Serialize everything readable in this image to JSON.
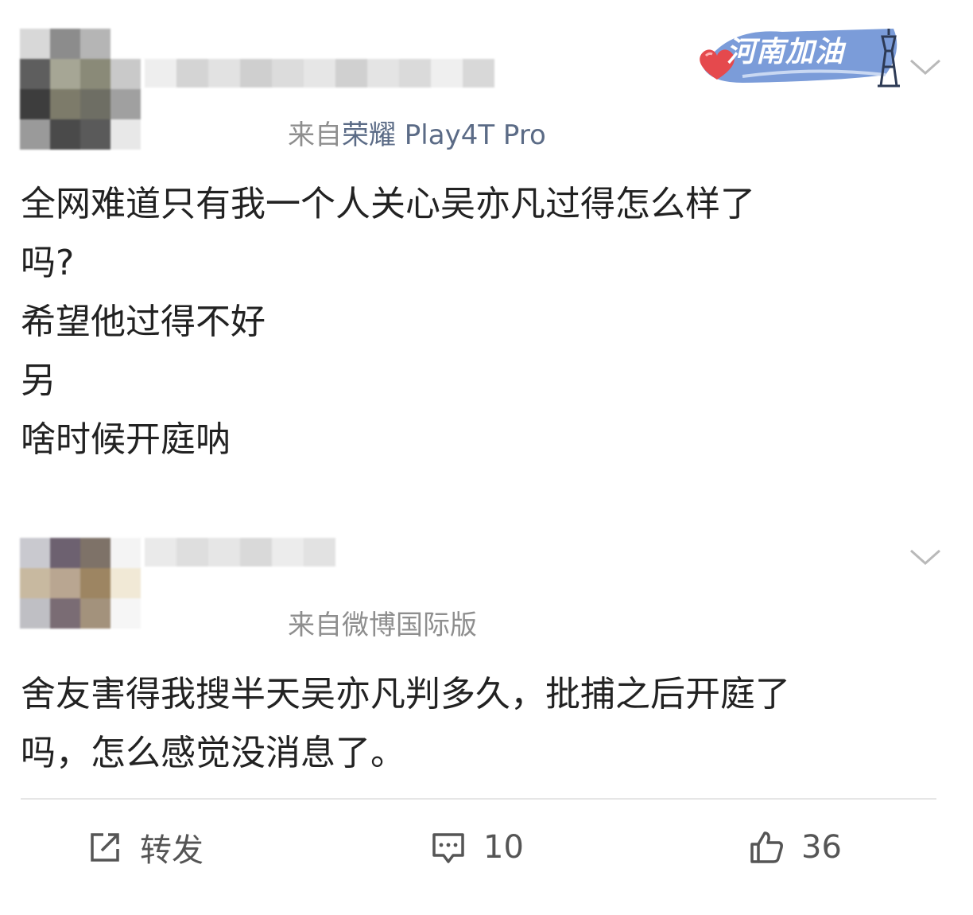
{
  "posts": [
    {
      "source_prefix": "来自",
      "source_device": "荣耀 Play4T Pro",
      "badge_text": "河南加油",
      "content": [
        "全网难道只有我一个人关心吴亦凡过得怎么样了",
        "吗?",
        "希望他过得不好",
        "另",
        "啥时候开庭呐"
      ],
      "avatar_colors": [
        "#d8d8d8",
        "#8c8c8c",
        "#b5b5b5",
        "#ffffff",
        "#5e5e5e",
        "#a6a695",
        "#8a8a78",
        "#c9c9c9",
        "#3d3d3d",
        "#7d7b6a",
        "#6e6e64",
        "#a0a0a0",
        "#9a9a9a",
        "#4a4a4a",
        "#5a5a5a",
        "#e8e8e8"
      ],
      "nick_colors": [
        "#eeeeee",
        "#d4d4d4",
        "#e2e2e2",
        "#cfcfcf",
        "#dcdcdc",
        "#e6e6e6",
        "#d0d0d0",
        "#e4e4e4",
        "#dadada",
        "#efefef",
        "#d8d8d8"
      ]
    },
    {
      "source_prefix": "来自",
      "source_device": "微博国际版",
      "content": [
        "舍友害得我搜半天吴亦凡判多久，批捕之后开庭了",
        "吗，怎么感觉没消息了。"
      ],
      "avatar_colors": [
        "#c9c9cf",
        "#6d6170",
        "#7e7268",
        "#f4f4f4",
        "#c8b9a0",
        "#b9a691",
        "#9d8562",
        "#f1e9d6",
        "#bfbfc4",
        "#7a6c74",
        "#a3927c",
        "#f6f6f6",
        "#ffffff",
        "#ffffff",
        "#ffffff",
        "#ffffff"
      ],
      "nick_colors": [
        "#eaeaea",
        "#dedede",
        "#e6e6e6",
        "#d9d9d9",
        "#ececec",
        "#e2e2e2"
      ]
    }
  ],
  "actions": {
    "repost_label": "转发",
    "comment_count": "10",
    "like_count": "36"
  },
  "icons": [
    "chevron-down-icon",
    "repost-icon",
    "comment-icon",
    "like-icon",
    "heart-icon",
    "tower-icon"
  ]
}
